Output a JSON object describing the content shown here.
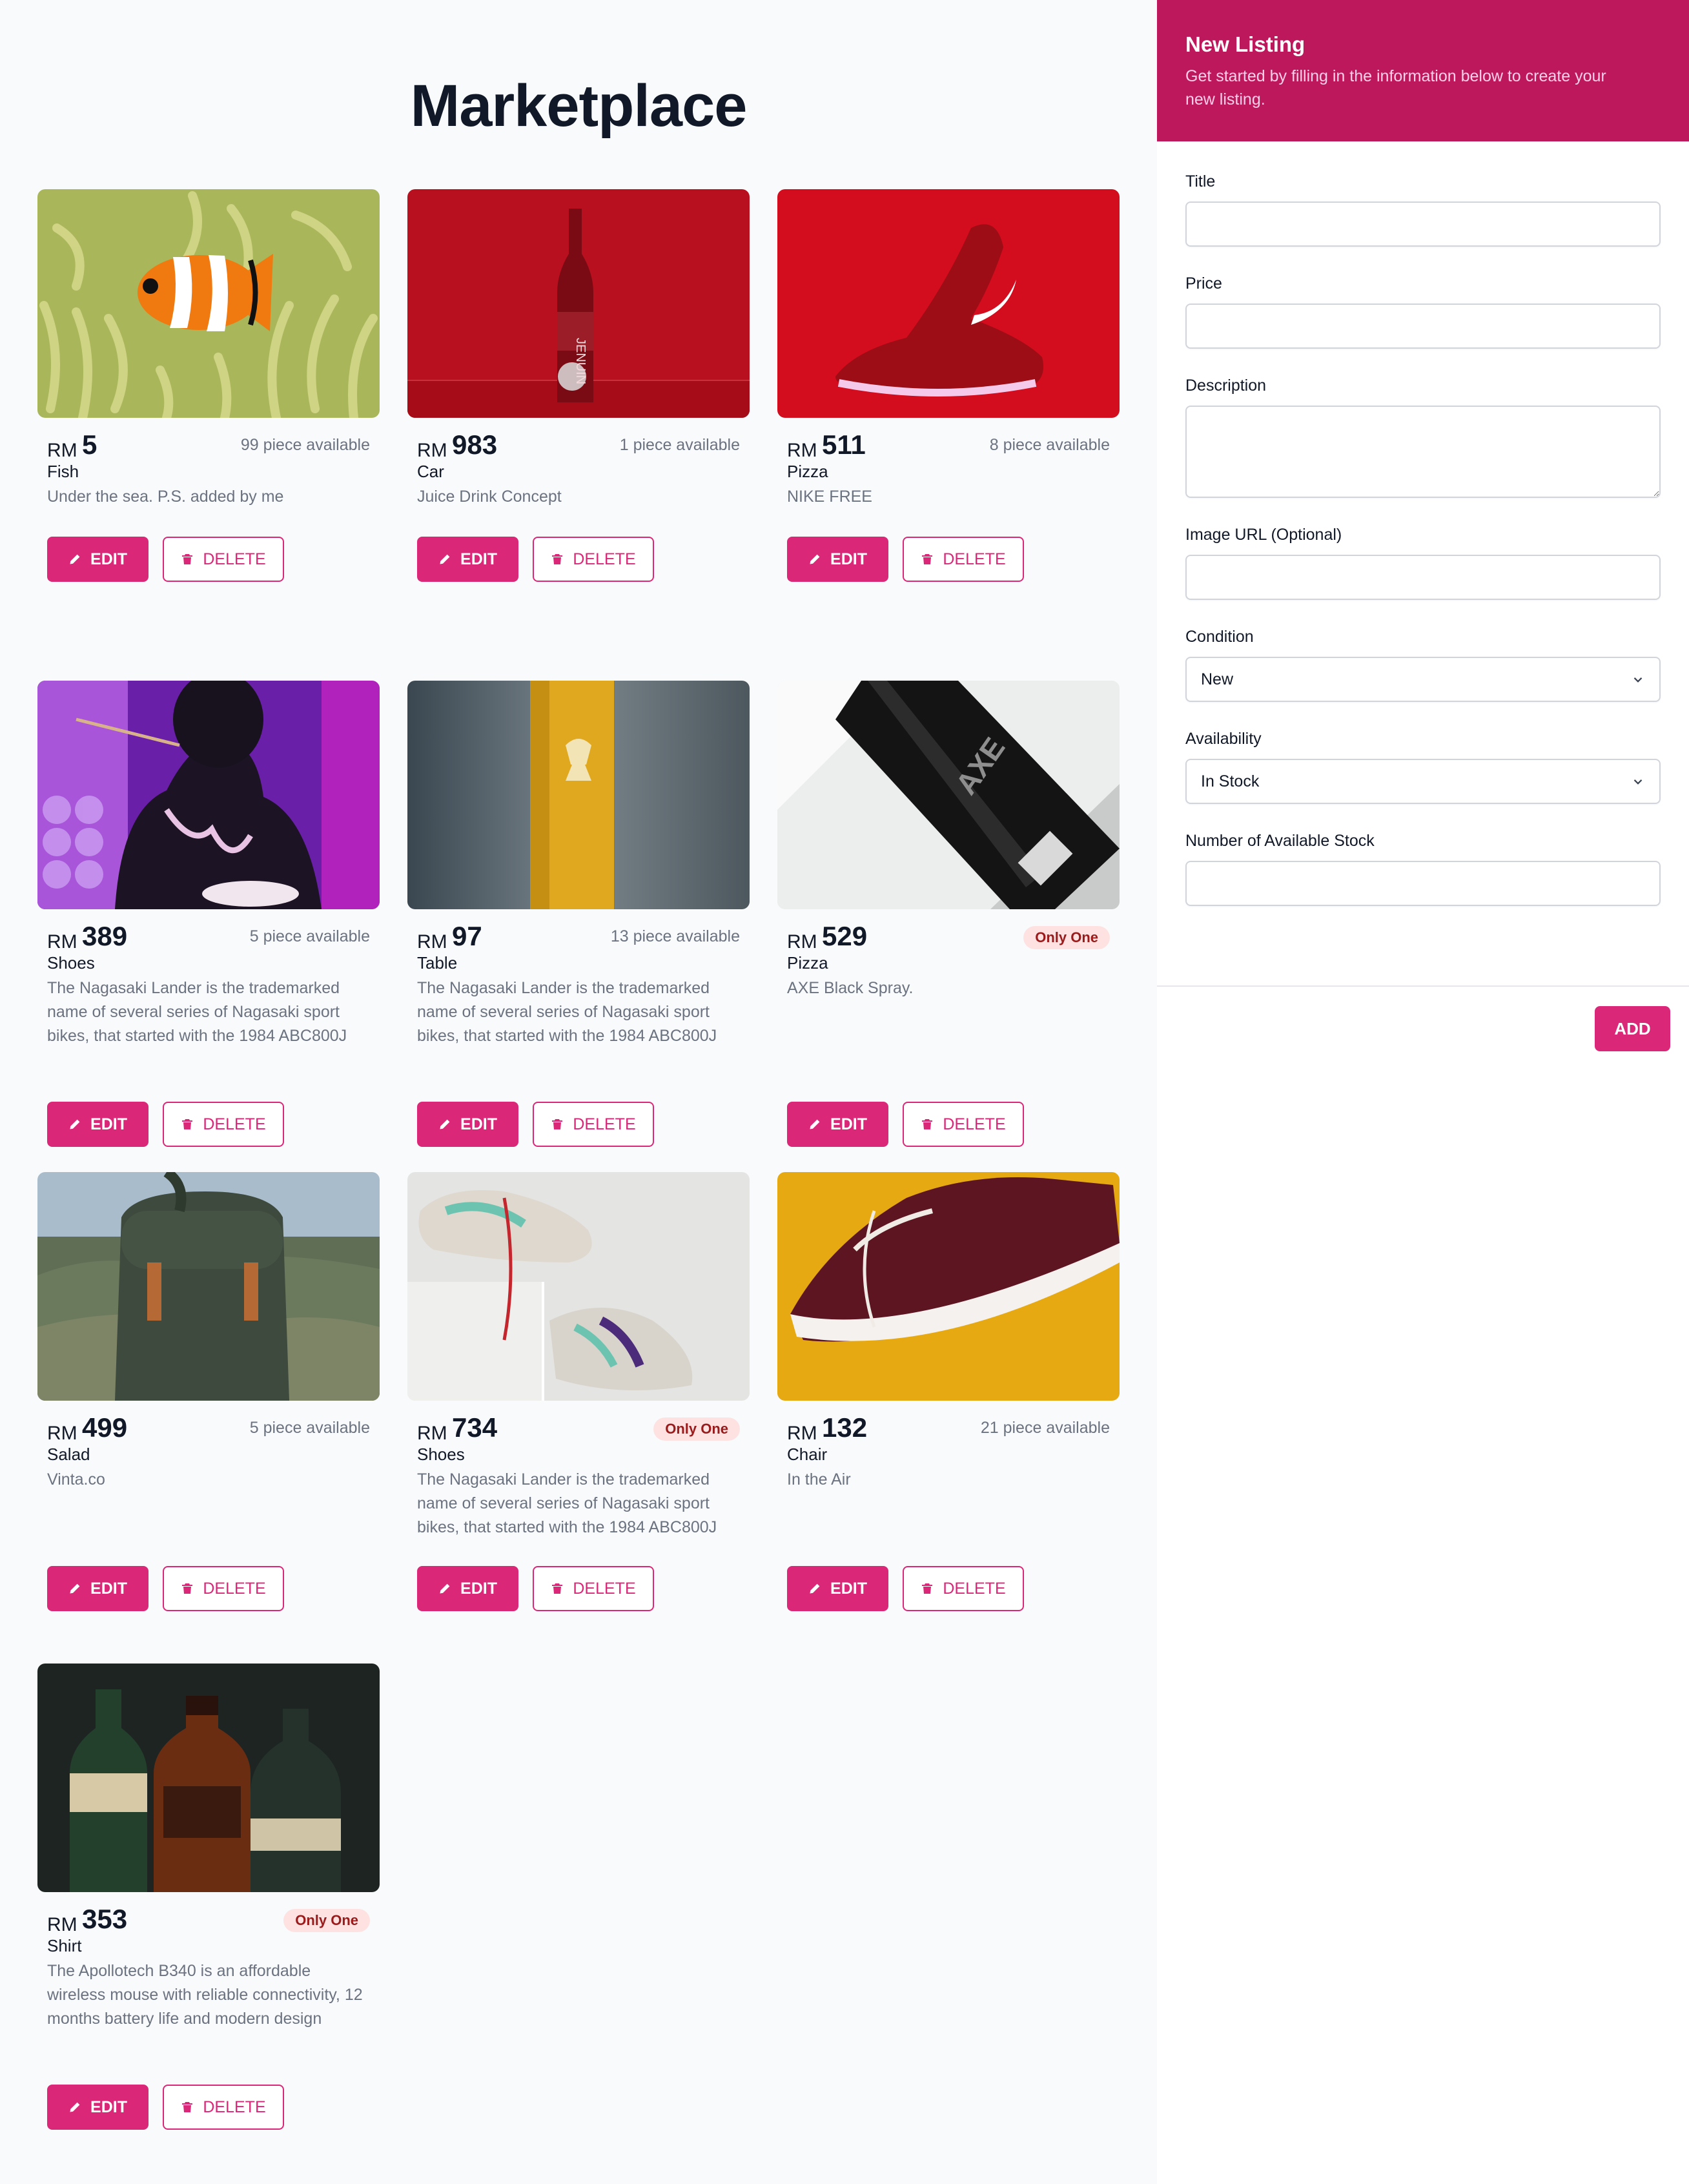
{
  "page": {
    "title": "Marketplace"
  },
  "listings": [
    {
      "currency": "RM",
      "price": "5",
      "stock": "99 piece available",
      "name": "Fish",
      "description": "Under the sea. P.S. added by me",
      "only_one": ""
    },
    {
      "currency": "RM",
      "price": "983",
      "stock": "1 piece available",
      "name": "Car",
      "description": "Juice Drink Concept",
      "only_one": ""
    },
    {
      "currency": "RM",
      "price": "511",
      "stock": "8 piece available",
      "name": "Pizza",
      "description": "NIKE FREE",
      "only_one": ""
    },
    {
      "currency": "RM",
      "price": "389",
      "stock": "5 piece available",
      "name": "Shoes",
      "description": "The Nagasaki Lander is the trademarked name of several series of Nagasaki sport bikes, that started with the 1984 ABC800J",
      "only_one": ""
    },
    {
      "currency": "RM",
      "price": "97",
      "stock": "13 piece available",
      "name": "Table",
      "description": "The Nagasaki Lander is the trademarked name of several series of Nagasaki sport bikes, that started with the 1984 ABC800J",
      "only_one": ""
    },
    {
      "currency": "RM",
      "price": "529",
      "stock": "",
      "name": "Pizza",
      "description": "AXE Black Spray.",
      "only_one": "Only One"
    },
    {
      "currency": "RM",
      "price": "499",
      "stock": "5 piece available",
      "name": "Salad",
      "description": "Vinta.co",
      "only_one": ""
    },
    {
      "currency": "RM",
      "price": "734",
      "stock": "",
      "name": "Shoes",
      "description": "The Nagasaki Lander is the trademarked name of several series of Nagasaki sport bikes, that started with the 1984 ABC800J",
      "only_one": "Only One"
    },
    {
      "currency": "RM",
      "price": "132",
      "stock": "21 piece available",
      "name": "Chair",
      "description": "In the Air",
      "only_one": ""
    },
    {
      "currency": "RM",
      "price": "353",
      "stock": "",
      "name": "Shirt",
      "description": "The Apollotech B340 is an affordable wireless mouse with reliable connectivity, 12 months battery life and modern design",
      "only_one": "Only One"
    }
  ],
  "card_actions": {
    "edit_label": "EDIT",
    "delete_label": "DELETE",
    "edit_icon": "pencil-icon",
    "delete_icon": "trash-icon"
  },
  "form": {
    "title": "New Listing",
    "subtitle": "Get started by filling in the information below to create your new listing.",
    "fields": {
      "title_label": "Title",
      "price_label": "Price",
      "description_label": "Description",
      "image_url_label": "Image URL (Optional)",
      "condition_label": "Condition",
      "condition_value": "New",
      "availability_label": "Availability",
      "availability_value": "In Stock",
      "stock_label": "Number of Available Stock"
    },
    "add_label": "ADD"
  },
  "colors": {
    "accent": "#db2777",
    "header": "#be185d",
    "badge_bg": "#fee2e2",
    "badge_text": "#991b1b"
  }
}
